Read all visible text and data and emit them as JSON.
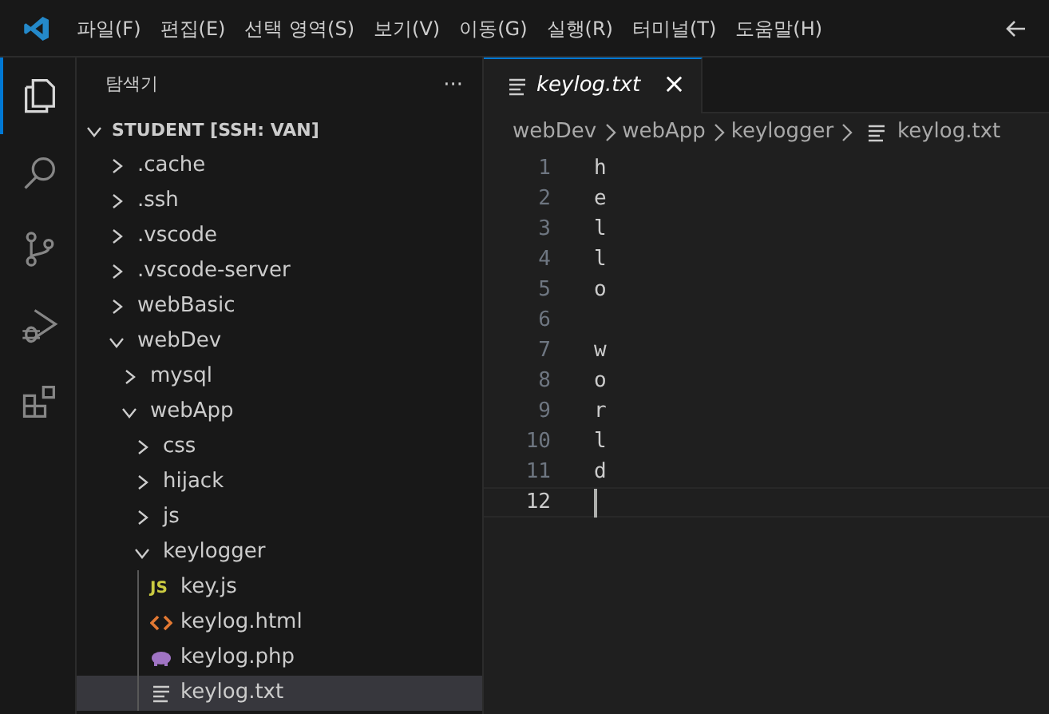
{
  "menu": [
    "파일(F)",
    "편집(E)",
    "선택 영역(S)",
    "보기(V)",
    "이동(G)",
    "실행(R)",
    "터미널(T)",
    "도움말(H)"
  ],
  "activity_bar": [
    {
      "kind": "explorer",
      "selected": true
    },
    {
      "kind": "search",
      "selected": false
    },
    {
      "kind": "source-control",
      "selected": false
    },
    {
      "kind": "run-debug",
      "selected": false
    },
    {
      "kind": "extensions",
      "selected": false
    }
  ],
  "sidebar": {
    "title": "탐색기",
    "more": "···",
    "section": "STUDENT [SSH: VAN]",
    "expanded": true,
    "tree": [
      {
        "label": ".cache",
        "kind": "folder",
        "expanded": false,
        "selected": false
      },
      {
        "label": ".ssh",
        "kind": "folder",
        "expanded": false,
        "selected": false
      },
      {
        "label": ".vscode",
        "kind": "folder",
        "expanded": false,
        "selected": false
      },
      {
        "label": ".vscode-server",
        "kind": "folder",
        "expanded": false,
        "selected": false
      },
      {
        "label": "webBasic",
        "kind": "folder",
        "expanded": false,
        "selected": false
      },
      {
        "label": "webDev",
        "kind": "folder",
        "expanded": true,
        "selected": false,
        "children": [
          {
            "label": "mysql",
            "kind": "folder",
            "expanded": false,
            "selected": false
          },
          {
            "label": "webApp",
            "kind": "folder",
            "expanded": true,
            "selected": false,
            "children": [
              {
                "label": "css",
                "kind": "folder",
                "expanded": false,
                "selected": false
              },
              {
                "label": "hijack",
                "kind": "folder",
                "expanded": false,
                "selected": false
              },
              {
                "label": "js",
                "kind": "folder",
                "expanded": false,
                "selected": false
              },
              {
                "label": "keylogger",
                "kind": "folder",
                "expanded": true,
                "selected": false,
                "children": [
                  {
                    "label": "key.js",
                    "kind": "js",
                    "icon_text": "JS",
                    "selected": false
                  },
                  {
                    "label": "keylog.html",
                    "kind": "html",
                    "selected": false
                  },
                  {
                    "label": "keylog.php",
                    "kind": "php",
                    "selected": false
                  },
                  {
                    "label": "keylog.txt",
                    "kind": "txt",
                    "selected": true
                  }
                ]
              }
            ]
          }
        ]
      }
    ]
  },
  "tabs": [
    {
      "label": "keylog.txt",
      "selected": true,
      "preview": true,
      "close": "×"
    }
  ],
  "breadcrumb": [
    "webDev",
    "webApp",
    "keylogger",
    "keylog.txt"
  ],
  "editor": {
    "lines": [
      {
        "number": "1",
        "text": "h",
        "current": false
      },
      {
        "number": "2",
        "text": "e",
        "current": false
      },
      {
        "number": "3",
        "text": "l",
        "current": false
      },
      {
        "number": "4",
        "text": "l",
        "current": false
      },
      {
        "number": "5",
        "text": "o",
        "current": false
      },
      {
        "number": "6",
        "current": false
      },
      {
        "number": "7",
        "text": "w",
        "current": false
      },
      {
        "number": "8",
        "text": "o",
        "current": false
      },
      {
        "number": "9",
        "text": "r",
        "current": false
      },
      {
        "number": "10",
        "text": "l",
        "current": false
      },
      {
        "number": "11",
        "text": "d",
        "current": false
      },
      {
        "number": "12",
        "current": true
      }
    ]
  }
}
